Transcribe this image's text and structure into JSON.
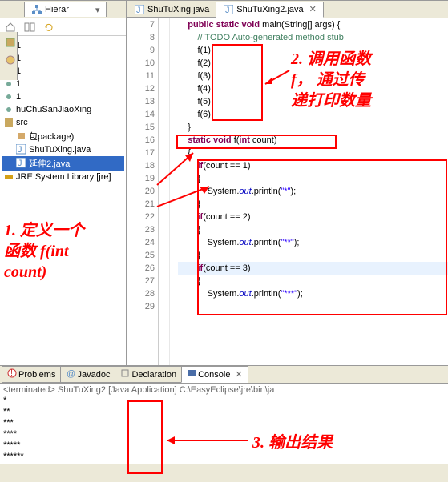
{
  "hierarchy_tab": "Hierar",
  "editor": {
    "tabs": [
      {
        "label": "ShuTuXing.java",
        "active": false
      },
      {
        "label": "ShuTuXing2.java",
        "active": true
      }
    ],
    "lines": [
      {
        "n": "7",
        "seg": [
          {
            "t": "    ",
            "c": ""
          },
          {
            "t": "public static void",
            "c": "kw"
          },
          {
            "t": " main(String[] args) {",
            "c": ""
          }
        ]
      },
      {
        "n": "8",
        "seg": [
          {
            "t": "        ",
            "c": ""
          },
          {
            "t": "// TODO Auto-generated method stub",
            "c": "cm"
          }
        ]
      },
      {
        "n": "9",
        "seg": [
          {
            "t": "        f(1);",
            "c": ""
          }
        ]
      },
      {
        "n": "10",
        "seg": [
          {
            "t": "        f(2);",
            "c": ""
          }
        ]
      },
      {
        "n": "11",
        "seg": [
          {
            "t": "        f(3);",
            "c": ""
          }
        ]
      },
      {
        "n": "12",
        "seg": [
          {
            "t": "        f(4);",
            "c": ""
          }
        ]
      },
      {
        "n": "13",
        "seg": [
          {
            "t": "        f(5);",
            "c": ""
          }
        ]
      },
      {
        "n": "14",
        "seg": [
          {
            "t": "        f(6);",
            "c": ""
          }
        ]
      },
      {
        "n": "15",
        "seg": [
          {
            "t": "    }",
            "c": ""
          }
        ]
      },
      {
        "n": "16",
        "seg": [
          {
            "t": "    ",
            "c": ""
          },
          {
            "t": "static void",
            "c": "kw"
          },
          {
            "t": " f(",
            "c": ""
          },
          {
            "t": "int",
            "c": "kw"
          },
          {
            "t": " count)",
            "c": ""
          }
        ]
      },
      {
        "n": "17",
        "seg": [
          {
            "t": "    {",
            "c": ""
          }
        ]
      },
      {
        "n": "18",
        "seg": [
          {
            "t": "        ",
            "c": ""
          },
          {
            "t": "if",
            "c": "kw"
          },
          {
            "t": "(count == 1)",
            "c": ""
          }
        ]
      },
      {
        "n": "19",
        "seg": [
          {
            "t": "        {",
            "c": ""
          }
        ]
      },
      {
        "n": "20",
        "seg": [
          {
            "t": "            System.",
            "c": ""
          },
          {
            "t": "out",
            "c": "fld"
          },
          {
            "t": ".println(",
            "c": ""
          },
          {
            "t": "\"*\"",
            "c": "str"
          },
          {
            "t": ");",
            "c": ""
          }
        ]
      },
      {
        "n": "21",
        "seg": [
          {
            "t": "        }",
            "c": ""
          }
        ]
      },
      {
        "n": "22",
        "seg": [
          {
            "t": "        ",
            "c": ""
          },
          {
            "t": "if",
            "c": "kw"
          },
          {
            "t": "(count == 2)",
            "c": ""
          }
        ]
      },
      {
        "n": "23",
        "seg": [
          {
            "t": "        {",
            "c": ""
          }
        ]
      },
      {
        "n": "24",
        "seg": [
          {
            "t": "            System.",
            "c": ""
          },
          {
            "t": "out",
            "c": "fld"
          },
          {
            "t": ".println(",
            "c": ""
          },
          {
            "t": "\"**\"",
            "c": "str"
          },
          {
            "t": ");",
            "c": ""
          }
        ]
      },
      {
        "n": "25",
        "seg": [
          {
            "t": "        }",
            "c": ""
          }
        ]
      },
      {
        "n": "26",
        "seg": [
          {
            "t": "        ",
            "c": ""
          },
          {
            "t": "if",
            "c": "kw"
          },
          {
            "t": "(count == 3)",
            "c": ""
          }
        ],
        "hl": true
      },
      {
        "n": "27",
        "seg": [
          {
            "t": "        {",
            "c": ""
          }
        ]
      },
      {
        "n": "28",
        "seg": [
          {
            "t": "            System.",
            "c": ""
          },
          {
            "t": "out",
            "c": "fld"
          },
          {
            "t": ".println(",
            "c": ""
          },
          {
            "t": "\"***\"",
            "c": "str"
          },
          {
            "t": ");",
            "c": ""
          }
        ]
      },
      {
        "n": "29",
        "seg": [
          {
            "t": " ",
            "c": ""
          }
        ]
      }
    ]
  },
  "tree": {
    "items": [
      {
        "label": "1"
      },
      {
        "label": "1"
      },
      {
        "label": "1"
      },
      {
        "label": "1"
      },
      {
        "label": "1"
      },
      {
        "label": "huChuSanJiaoXing"
      },
      {
        "label": "src",
        "pkg": true
      },
      {
        "label": "包package)",
        "pkg2": true,
        "sub": true
      },
      {
        "label": "ShuTuXing.java",
        "j": true,
        "sub": true
      },
      {
        "label": "延伸2.java",
        "j": true,
        "sub": true,
        "sel": true
      },
      {
        "label": "JRE System Library [jre]",
        "lib": true
      }
    ]
  },
  "bottom": {
    "tabs": [
      {
        "label": "Problems"
      },
      {
        "label": "Javadoc"
      },
      {
        "label": "Declaration"
      },
      {
        "label": "Console",
        "active": true
      }
    ],
    "term": "<terminated> ShuTuXing2 [Java Application] C:\\EasyEclipse\\jre\\bin\\ja",
    "output": [
      "*",
      "**",
      "***",
      "****",
      "*****",
      "******"
    ]
  },
  "annotations": {
    "a1": "1. 定义一个\n函数 f(int\ncount)",
    "a2": "2. 调用函数\nf， 通过传\n递打印数量",
    "a3": "3. 输出结果"
  }
}
